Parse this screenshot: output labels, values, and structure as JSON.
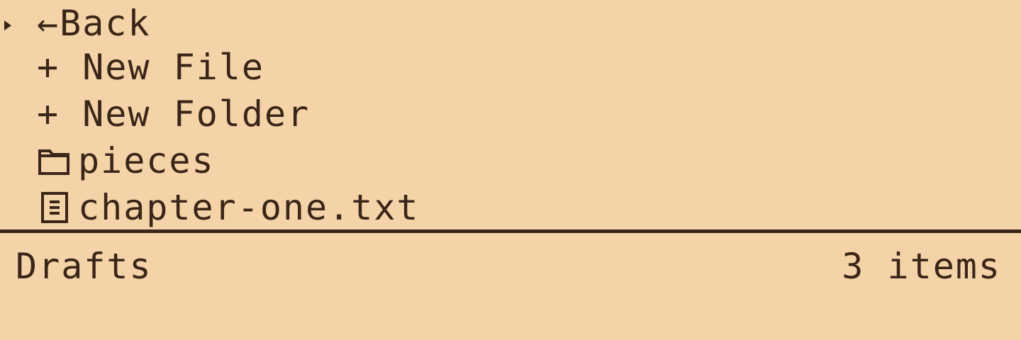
{
  "browser": {
    "items": [
      {
        "icon": "back-arrow-icon",
        "label": "←Back",
        "selected": true
      },
      {
        "icon": "plus-icon",
        "label": "+ New File",
        "selected": false
      },
      {
        "icon": "plus-icon",
        "label": "+ New Folder",
        "selected": false
      },
      {
        "icon": "folder-icon",
        "label": "pieces",
        "selected": false
      },
      {
        "icon": "file-icon",
        "label": "chapter-one.txt",
        "selected": false
      }
    ]
  },
  "status_bar": {
    "folder_name": "Drafts",
    "item_count": "3 items"
  },
  "colors": {
    "background": "#f5d3a8",
    "foreground": "#3a2618"
  }
}
